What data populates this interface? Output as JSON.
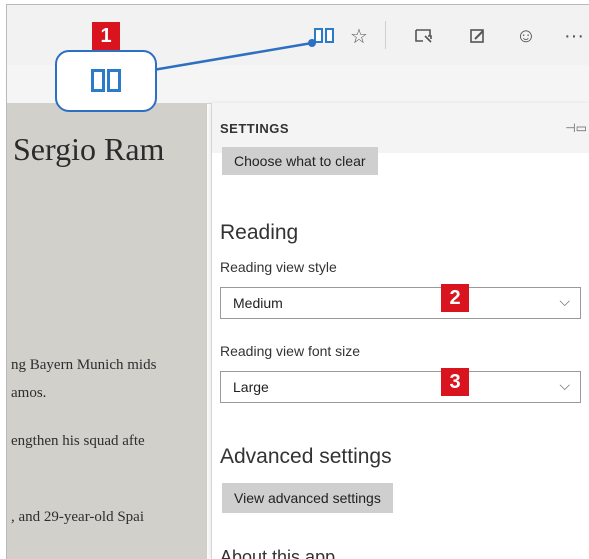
{
  "toolbar": {
    "icons": [
      "reading-view-icon",
      "favorite-star-icon",
      "hub-icon",
      "web-note-icon",
      "feedback-smiley-icon",
      "more-icon"
    ],
    "more_label": "···"
  },
  "article": {
    "title": "Sergio Ram",
    "lines": [
      "ng Bayern Munich mids",
      "amos.",
      "engthen his squad afte",
      ", and 29-year-old Spai"
    ]
  },
  "settings": {
    "title": "SETTINGS",
    "clear_button": "Choose what to clear",
    "reading_heading": "Reading",
    "reading_style_label": "Reading view style",
    "reading_style_value": "Medium",
    "font_size_label": "Reading view font size",
    "font_size_value": "Large",
    "advanced_heading": "Advanced settings",
    "advanced_button": "View advanced settings",
    "about_heading": "About this app"
  },
  "badges": {
    "one": "1",
    "two": "2",
    "three": "3"
  },
  "colors": {
    "badge": "#d9141e",
    "callout_border": "#2d6fc2",
    "reading_icon": "#2a7bc9"
  }
}
